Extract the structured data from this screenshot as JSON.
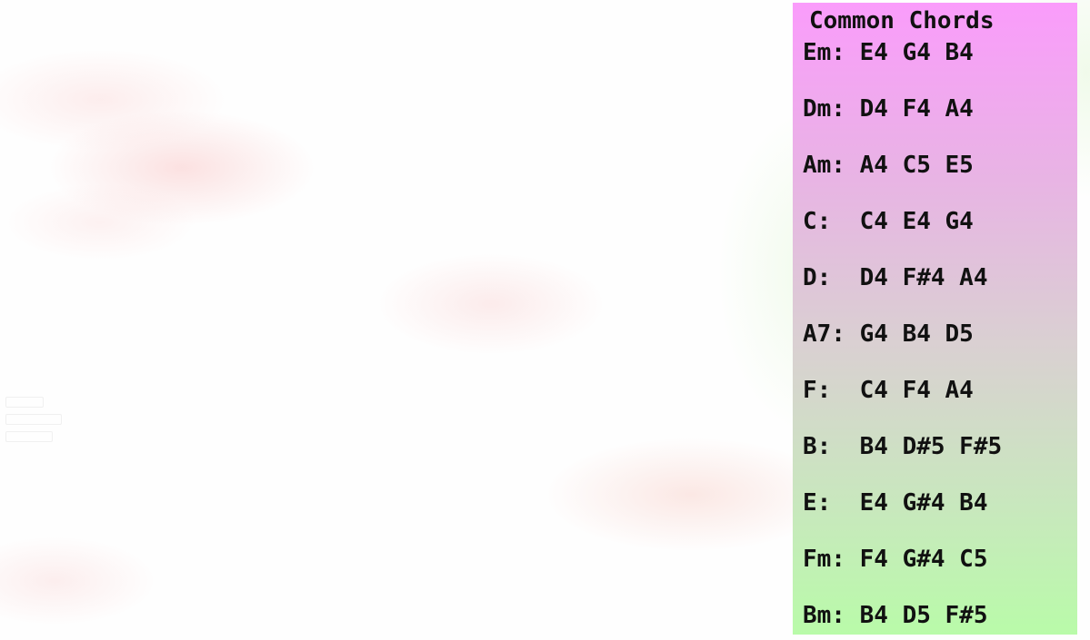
{
  "panel": {
    "title": "Common Chords",
    "chords": [
      {
        "line": "Em: E4 G4 B4"
      },
      {
        "line": "Dm: D4 F4 A4"
      },
      {
        "line": "Am: A4 C5 E5"
      },
      {
        "line": "C:  C4 E4 G4"
      },
      {
        "line": "D:  D4 F#4 A4"
      },
      {
        "line": "A7: G4 B4 D5"
      },
      {
        "line": "F:  C4 F4 A4"
      },
      {
        "line": "B:  B4 D#5 F#5"
      },
      {
        "line": "E:  E4 G#4 B4"
      },
      {
        "line": "Fm: F4 G#4 C5"
      },
      {
        "line": "Bm: B4 D5 F#5"
      }
    ]
  },
  "colors": {
    "panel_top": "#fa9cfb",
    "panel_bottom": "#b9fba9",
    "text": "#111111"
  }
}
